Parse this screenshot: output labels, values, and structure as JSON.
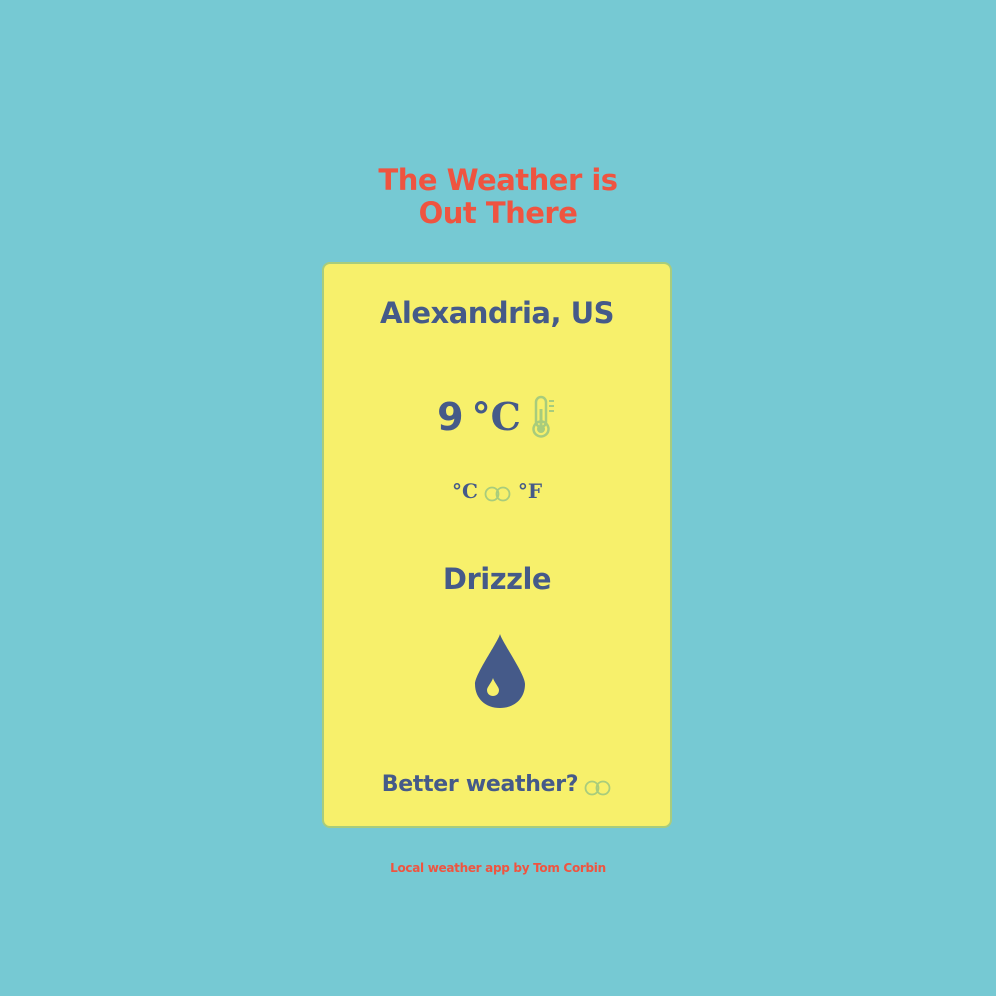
{
  "header": {
    "title_line1": "The Weather is",
    "title_line2": "Out There"
  },
  "card": {
    "location": "Alexandria, US",
    "temperature": {
      "value": "9",
      "unit": "°C",
      "icon": "thermometer-icon"
    },
    "unit_toggle": {
      "celsius_label": "°C",
      "fahrenheit_label": "°F",
      "selected": "°C"
    },
    "condition": "Drizzle",
    "condition_icon": "raindrop-icon",
    "better_weather": {
      "label": "Better weather?",
      "enabled": false
    }
  },
  "footer": {
    "credit": "Local weather app by Tom Corbin"
  },
  "colors": {
    "background": "#76c9d3",
    "card": "#f7f06b",
    "card_border": "#a8cc7c",
    "accent": "#ef5440",
    "text": "#455a89",
    "toggle": "#a8cc7c"
  }
}
